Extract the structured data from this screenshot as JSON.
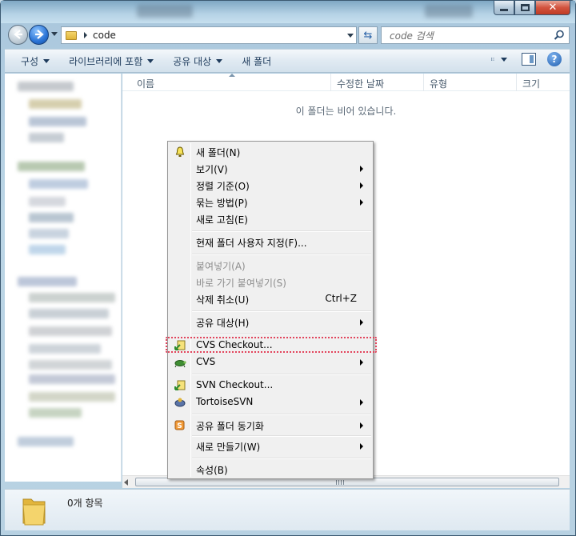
{
  "address": {
    "folder": "code"
  },
  "search": {
    "placeholder": "code 검색"
  },
  "toolbar": {
    "organize": "구성",
    "library": "라이브러리에 포함",
    "share": "공유 대상",
    "new_folder": "새 폴더"
  },
  "columns": {
    "name": "이름",
    "modified": "수정한 날짜",
    "type": "유형",
    "size": "크기"
  },
  "empty_message": "이 폴더는 비어 있습니다.",
  "details": {
    "count": "0개 항목"
  },
  "menu": {
    "new_folder": "새 폴더(N)",
    "view": "보기(V)",
    "sort": "정렬 기준(O)",
    "group": "묶는 방법(P)",
    "refresh": "새로 고침(E)",
    "customize": "현재 폴더 사용자 지정(F)...",
    "paste": "붙여넣기(A)",
    "paste_shortcut": "바로 가기 붙여넣기(S)",
    "undo_delete": "삭제 취소(U)",
    "undo_shortcut": "Ctrl+Z",
    "share": "공유 대상(H)",
    "cvs_checkout": "CVS Checkout...",
    "cvs": "CVS",
    "svn_checkout": "SVN Checkout...",
    "tortoise": "TortoiseSVN",
    "sync": "공유 폴더 동기화",
    "new": "새로 만들기(W)",
    "properties": "속성(B)"
  },
  "colors": {
    "accent": "#2a74d6",
    "highlight": "#e2445c"
  }
}
